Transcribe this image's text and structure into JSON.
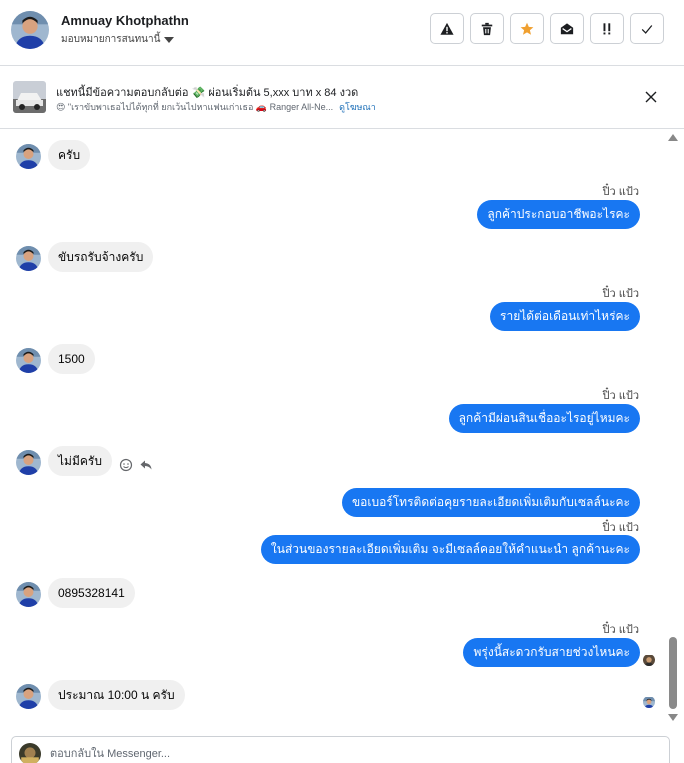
{
  "header": {
    "contact_name": "Amnuay Khotphathn",
    "assign_label": "มอบหมายการสนทนานี้",
    "toolbar": [
      {
        "icon": "warning-icon",
        "name": "report-spam-button"
      },
      {
        "icon": "trash-icon",
        "name": "delete-button"
      },
      {
        "icon": "star-icon",
        "name": "star-button"
      },
      {
        "icon": "envelope-open-icon",
        "name": "mark-unread-button"
      },
      {
        "icon": "follow-up-icon",
        "name": "follow-up-button"
      },
      {
        "icon": "check-icon",
        "name": "mark-done-button"
      }
    ]
  },
  "ad": {
    "title": "แชทนี้มีข้อความตอบกลับต่อ 💸 ผ่อนเริ่มต้น 5,xxx บาท x 84 งวด",
    "subtitle": "😍 \"เราขับพาเธอไปได้ทุกที่ ยกเว้นไปหาแฟนเก่าเธอ 🚗 Ranger All-Ne...",
    "link": "ดูโฆษณา"
  },
  "messages": {
    "m1": "ครับ",
    "s2": "ปิ๋ว แป้ว",
    "m2": "ลูกค้าประกอบอาชีพอะไรคะ",
    "m3": "ขับรถรับจ้างครับ",
    "s4": "ปิ๋ว แป้ว",
    "m4": "รายได้ต่อเดือนเท่าไหร่คะ",
    "m5": "1500",
    "s6": "ปิ๋ว แป้ว",
    "m6": "ลูกค้ามีผ่อนสินเชื่ออะไรอยู่ไหมคะ",
    "m7": "ไม่มีครับ",
    "m8": "ขอเบอร์โทรติดต่อคุยรายละเอียดเพิ่มเติมกับเซลล์นะคะ",
    "s9": "ปิ๋ว แป้ว",
    "m9": "ในส่วนของรายละเอียดเพิ่มเติม จะมีเซลล์คอยให้คำแนะนำ ลูกค้านะคะ",
    "m10": "0895328141",
    "s11": "ปิ๋ว แป้ว",
    "m11": "พรุ่งนี้สะดวกรับสายช่วงไหนคะ",
    "m12": "ประมาณ 10:00 น ครับ"
  },
  "composer": {
    "placeholder": "ตอบกลับใน Messenger..."
  },
  "colors": {
    "outgoing": "#1877f2",
    "incoming": "#f0f0f0",
    "star": "#f0a030"
  }
}
